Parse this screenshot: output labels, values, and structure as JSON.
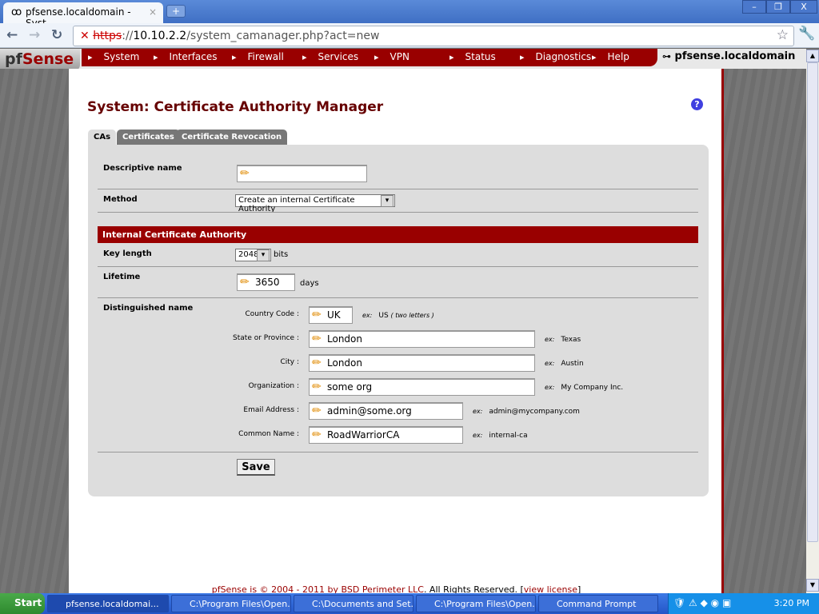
{
  "browser": {
    "tab_title": "pfsense.localdomain - Syst...",
    "url_scheme": "https",
    "url_rest": "://",
    "url_host": "10.10.2.2",
    "url_path": "/system_camanager.php?act=new"
  },
  "nav": {
    "logo_pf": "pf",
    "logo_sense": "Sense",
    "items": [
      "System",
      "Interfaces",
      "Firewall",
      "Services",
      "VPN",
      "Status",
      "Diagnostics",
      "Help"
    ],
    "hostname": "pfsense.localdomain"
  },
  "page": {
    "title": "System: Certificate Authority Manager",
    "help": "?"
  },
  "tabs": [
    "CAs",
    "Certificates",
    "Certificate Revocation"
  ],
  "form": {
    "descriptive_name_label": "Descriptive name",
    "descriptive_name_value": "",
    "method_label": "Method",
    "method_value": "Create an internal Certificate Authority",
    "section_header": "Internal Certificate Authority",
    "key_length_label": "Key length",
    "key_length_value": "2048",
    "key_length_unit": "bits",
    "lifetime_label": "Lifetime",
    "lifetime_value": "3650",
    "lifetime_unit": "days",
    "dn_label": "Distinguished name",
    "dn_fields": [
      {
        "label": "Country Code :",
        "value": "UK",
        "example": "US",
        "note": "( two letters )"
      },
      {
        "label": "State or Province :",
        "value": "London",
        "example": "Texas"
      },
      {
        "label": "City :",
        "value": "London",
        "example": "Austin"
      },
      {
        "label": "Organization :",
        "value": "some org",
        "example": "My Company Inc."
      },
      {
        "label": "Email Address :",
        "value": "admin@some.org",
        "example": "admin@mycompany.com"
      },
      {
        "label": "Common Name :",
        "value": "RoadWarriorCA",
        "example": "internal-ca"
      }
    ],
    "example_prefix": "ex:",
    "save": "Save"
  },
  "footer": {
    "pre": "pfSense is © 2004 - 2011 by ",
    "company": "BSD Perimeter LLC",
    "post": ". All Rights Reserved. [",
    "link": "view license",
    "end": "]"
  },
  "taskbar": {
    "start": "Start",
    "tasks": [
      "pfsense.localdomai...",
      "C:\\Program Files\\Open...",
      "C:\\Documents and Set...",
      "C:\\Program Files\\Open...",
      "Command Prompt"
    ],
    "clock": "3:20 PM"
  }
}
